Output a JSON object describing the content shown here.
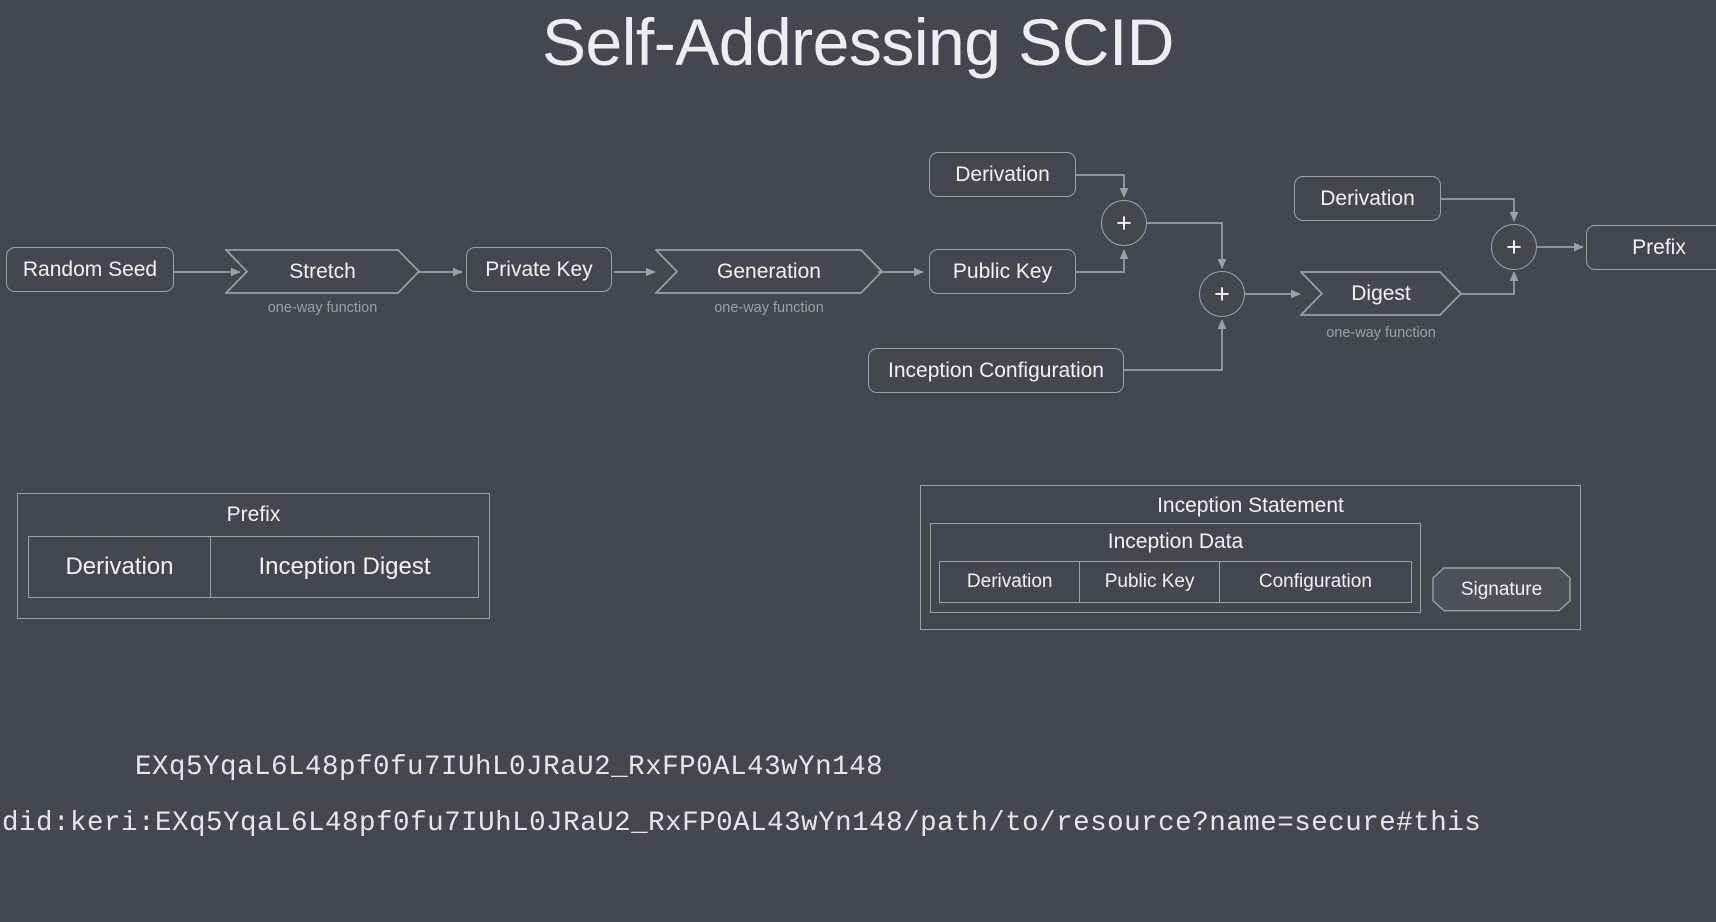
{
  "title": "Self-Addressing SCID",
  "flow": {
    "random_seed": "Random Seed",
    "stretch": "Stretch",
    "stretch_note": "one-way function",
    "private_key": "Private Key",
    "generation": "Generation",
    "generation_note": "one-way function",
    "derivation_top": "Derivation",
    "public_key": "Public Key",
    "inception_configuration": "Inception Configuration",
    "derivation_right": "Derivation",
    "digest": "Digest",
    "digest_note": "one-way function",
    "prefix": "Prefix",
    "plus_sign": "+"
  },
  "prefix_table": {
    "title": "Prefix",
    "cells": [
      "Derivation",
      "Inception Digest"
    ]
  },
  "inception_statement": {
    "title": "Inception Statement",
    "data_title": "Inception Data",
    "data_cells": [
      "Derivation",
      "Public Key",
      "Configuration"
    ],
    "signature": "Signature"
  },
  "strings": {
    "scid": "EXq5YqaL6L48pf0fu7IUhL0JRaU2_RxFP0AL43wYn148",
    "did": "did:keri:EXq5YqaL6L48pf0fu7IUhL0JRaU2_RxFP0AL43wYn148/path/to/resource?name=secure#this"
  },
  "colors": {
    "background": "#434750",
    "stroke": "#9aa0a6",
    "text": "#f0f2f4",
    "muted": "#9aa0a6",
    "badge_fill": "#4d5159"
  }
}
